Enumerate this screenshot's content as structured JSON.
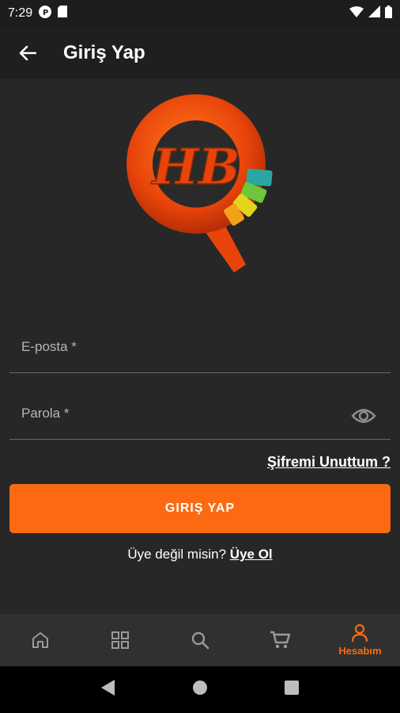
{
  "status_bar": {
    "time": "7:29"
  },
  "app_bar": {
    "title": "Giriş Yap"
  },
  "logo": {
    "text": "HB"
  },
  "form": {
    "email_label": "E-posta *",
    "password_label": "Parola *",
    "forgot_password": "Şifremi Unuttum ?",
    "login_button": "GIRIŞ YAP",
    "register_prompt": "Üye değil misin?",
    "register_link": "Üye Ol"
  },
  "bottom_nav": {
    "items": [
      {
        "icon": "home-icon"
      },
      {
        "icon": "grid-icon"
      },
      {
        "icon": "search-icon"
      },
      {
        "icon": "cart-icon"
      },
      {
        "icon": "person-icon",
        "label": "Hesabım",
        "active": true
      }
    ]
  },
  "colors": {
    "accent": "#fb6a12",
    "background": "#272727",
    "app_bar": "#1f1f1f"
  }
}
